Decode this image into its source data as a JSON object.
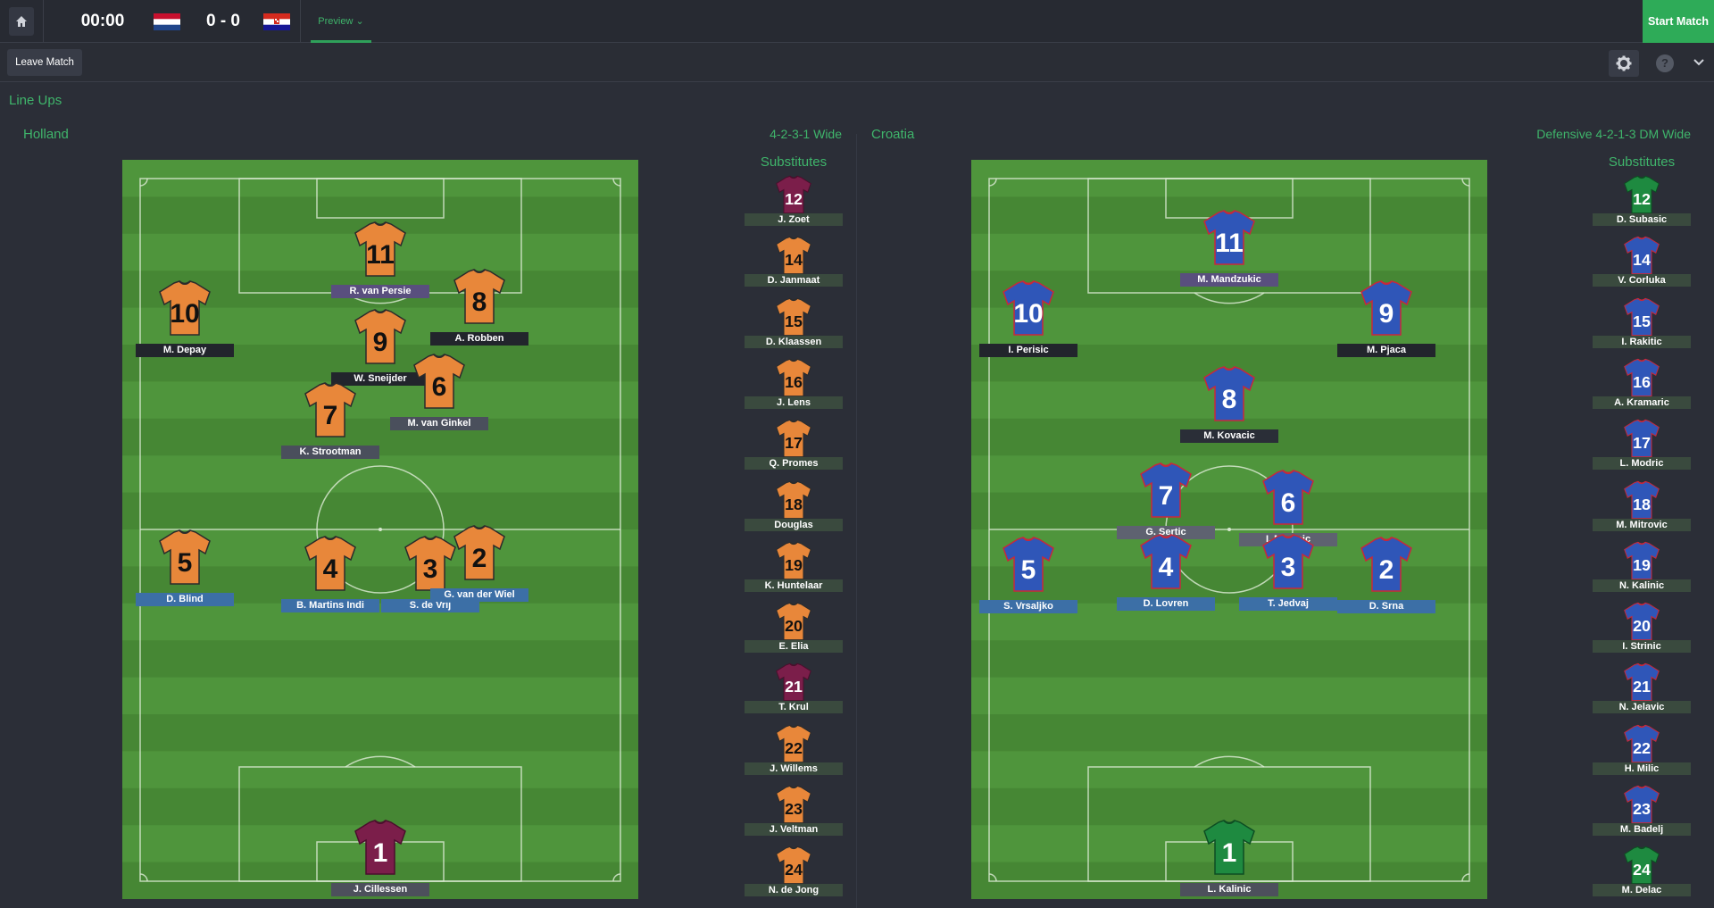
{
  "header": {
    "clock": "00:00",
    "score": "0 - 0",
    "preview_tab": "Preview",
    "start_button": "Start Match",
    "leave_button": "Leave Match",
    "help_label": "?"
  },
  "colors": {
    "accent": "#3fb56b",
    "pitch_light": "#4f953c",
    "pitch_dark": "#468734",
    "home_shirt": "#e8873a",
    "home_gk_shirt": "#7b1e4a",
    "away_shirt": "#2f56b8",
    "away_gk_shirt": "#1e8a40"
  },
  "section_title": "Line Ups",
  "home": {
    "name": "Holland",
    "formation": "4-2-3-1 Wide",
    "subs_title": "Substitutes",
    "starters": [
      {
        "num": "11",
        "name": "R. van Persie",
        "role": "att"
      },
      {
        "num": "10",
        "name": "M. Depay",
        "role": "mid"
      },
      {
        "num": "9",
        "name": "W. Sneijder",
        "role": "att"
      },
      {
        "num": "8",
        "name": "A. Robben",
        "role": "mid"
      },
      {
        "num": "6",
        "name": "M. van Ginkel",
        "role": "mid"
      },
      {
        "num": "7",
        "name": "K. Strootman",
        "role": "mid"
      },
      {
        "num": "5",
        "name": "D. Blind",
        "role": "def"
      },
      {
        "num": "4",
        "name": "B. Martins Indi",
        "role": "def"
      },
      {
        "num": "3",
        "name": "S. de Vrij",
        "role": "def"
      },
      {
        "num": "2",
        "name": "G. van der Wiel",
        "role": "def"
      },
      {
        "num": "1",
        "name": "J. Cillessen",
        "role": "gk"
      }
    ],
    "subs": [
      {
        "num": "12",
        "name": "J. Zoet",
        "gk": true
      },
      {
        "num": "14",
        "name": "D. Janmaat",
        "gk": false
      },
      {
        "num": "15",
        "name": "D. Klaassen",
        "gk": false
      },
      {
        "num": "16",
        "name": "J. Lens",
        "gk": false
      },
      {
        "num": "17",
        "name": "Q. Promes",
        "gk": false
      },
      {
        "num": "18",
        "name": "Douglas",
        "gk": false
      },
      {
        "num": "19",
        "name": "K. Huntelaar",
        "gk": false
      },
      {
        "num": "20",
        "name": "E. Elia",
        "gk": false
      },
      {
        "num": "21",
        "name": "T. Krul",
        "gk": true
      },
      {
        "num": "22",
        "name": "J. Willems",
        "gk": false
      },
      {
        "num": "23",
        "name": "J. Veltman",
        "gk": false
      },
      {
        "num": "24",
        "name": "N. de Jong",
        "gk": false
      }
    ]
  },
  "away": {
    "name": "Croatia",
    "formation": "Defensive 4-2-1-3 DM Wide",
    "subs_title": "Substitutes",
    "starters": [
      {
        "num": "11",
        "name": "M. Mandzukic",
        "role": "att"
      },
      {
        "num": "10",
        "name": "I. Perisic",
        "role": "mid"
      },
      {
        "num": "9",
        "name": "M. Pjaca",
        "role": "mid"
      },
      {
        "num": "8",
        "name": "M. Kovacic",
        "role": "mid"
      },
      {
        "num": "7",
        "name": "G. Sertic",
        "role": "dm"
      },
      {
        "num": "6",
        "name": "I. Mocinic",
        "role": "dm"
      },
      {
        "num": "5",
        "name": "S. Vrsaljko",
        "role": "def"
      },
      {
        "num": "4",
        "name": "D. Lovren",
        "role": "def"
      },
      {
        "num": "3",
        "name": "T. Jedvaj",
        "role": "def"
      },
      {
        "num": "2",
        "name": "D. Srna",
        "role": "def"
      },
      {
        "num": "1",
        "name": "L. Kalinic",
        "role": "gk"
      }
    ],
    "subs": [
      {
        "num": "12",
        "name": "D. Subasic",
        "gk": true
      },
      {
        "num": "14",
        "name": "V. Corluka",
        "gk": false
      },
      {
        "num": "15",
        "name": "I. Rakitic",
        "gk": false
      },
      {
        "num": "16",
        "name": "A. Kramaric",
        "gk": false
      },
      {
        "num": "17",
        "name": "L. Modric",
        "gk": false
      },
      {
        "num": "18",
        "name": "M. Mitrovic",
        "gk": false
      },
      {
        "num": "19",
        "name": "N. Kalinic",
        "gk": false
      },
      {
        "num": "20",
        "name": "I. Strinic",
        "gk": false
      },
      {
        "num": "21",
        "name": "N. Jelavic",
        "gk": false
      },
      {
        "num": "22",
        "name": "H. Milic",
        "gk": false
      },
      {
        "num": "23",
        "name": "M. Badelj",
        "gk": false
      },
      {
        "num": "24",
        "name": "M. Delac",
        "gk": true
      }
    ]
  }
}
